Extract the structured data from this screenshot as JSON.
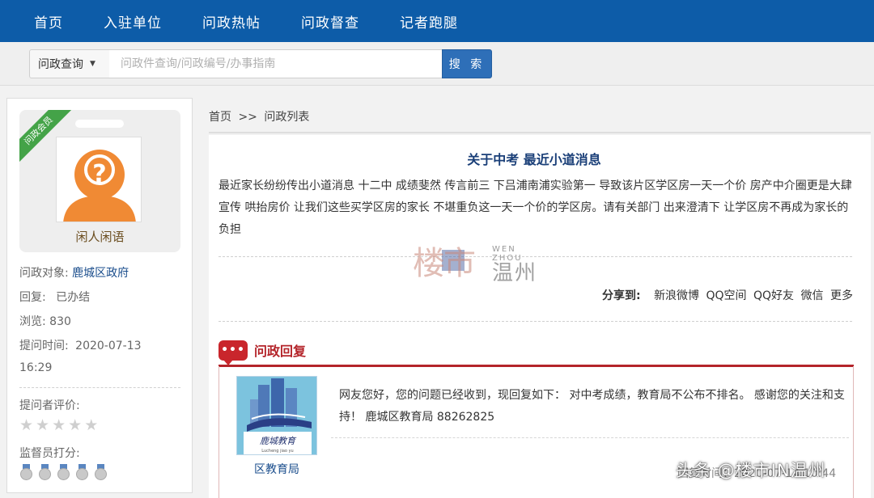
{
  "nav": {
    "items": [
      "首页",
      "入驻单位",
      "问政热帖",
      "问政督查",
      "记者跑腿"
    ]
  },
  "search": {
    "select_value": "问政查询",
    "placeholder": "问政件查询/问政编号/办事指南",
    "button_label": "搜 索"
  },
  "sidebar": {
    "ribbon": "问政会员",
    "nickname": "闲人闲语",
    "target_label": "问政对象:",
    "target_value": "鹿城区政府",
    "reply_label": "回复:",
    "reply_value": "已办结",
    "views_label": "浏览:",
    "views_value": "830",
    "asked_label": "提问时间:",
    "asked_date": "2020-07-13",
    "asked_time": "16:29",
    "asker_rating_label": "提问者评价:",
    "asker_rating_stars": 0,
    "supervisor_label": "监督员打分:",
    "supervisor_medals": 5
  },
  "breadcrumb": {
    "home": "首页",
    "sep": ">>",
    "current": "问政列表"
  },
  "post": {
    "title": "关于中考 最近小道消息",
    "body": "最近家长纷纷传出小道消息 十二中 成绩斐然 传言前三 下吕浦南浦实验第一 导致该片区学区房一天一个价 房产中介圈更是大肆宣传 哄抬房价 让我们这些买学区房的家长 不堪重负这一天一个价的学区房。请有关部门 出来澄清下 让学区房不再成为家长的负担"
  },
  "watermark": {
    "brand_cn": "楼市",
    "en": "WEN ZHOU",
    "city": "温州"
  },
  "share": {
    "label": "分享到:",
    "links": [
      "新浪微博",
      "QQ空间",
      "QQ好友",
      "微信",
      "更多"
    ]
  },
  "reply": {
    "section_title": "问政回复",
    "org_name": "区教育局",
    "logo_text": "鹿城教育",
    "logo_subtext": "Lucheng jiao yu",
    "text": "网友您好，您的问题已经收到，现回复如下： 对中考成绩，教育局不公布不排名。 感谢您的关注和支持！ 鹿城区教育局 88262825",
    "time": "回复时间：2020-07-14 10:44"
  },
  "overlay": {
    "toutiao": "头条 @楼市IN温州"
  },
  "colors": {
    "nav_bg": "#0d5ca8",
    "accent_red": "#b4242a",
    "link_blue": "#1a4d8c",
    "ribbon_green": "#44a348"
  }
}
